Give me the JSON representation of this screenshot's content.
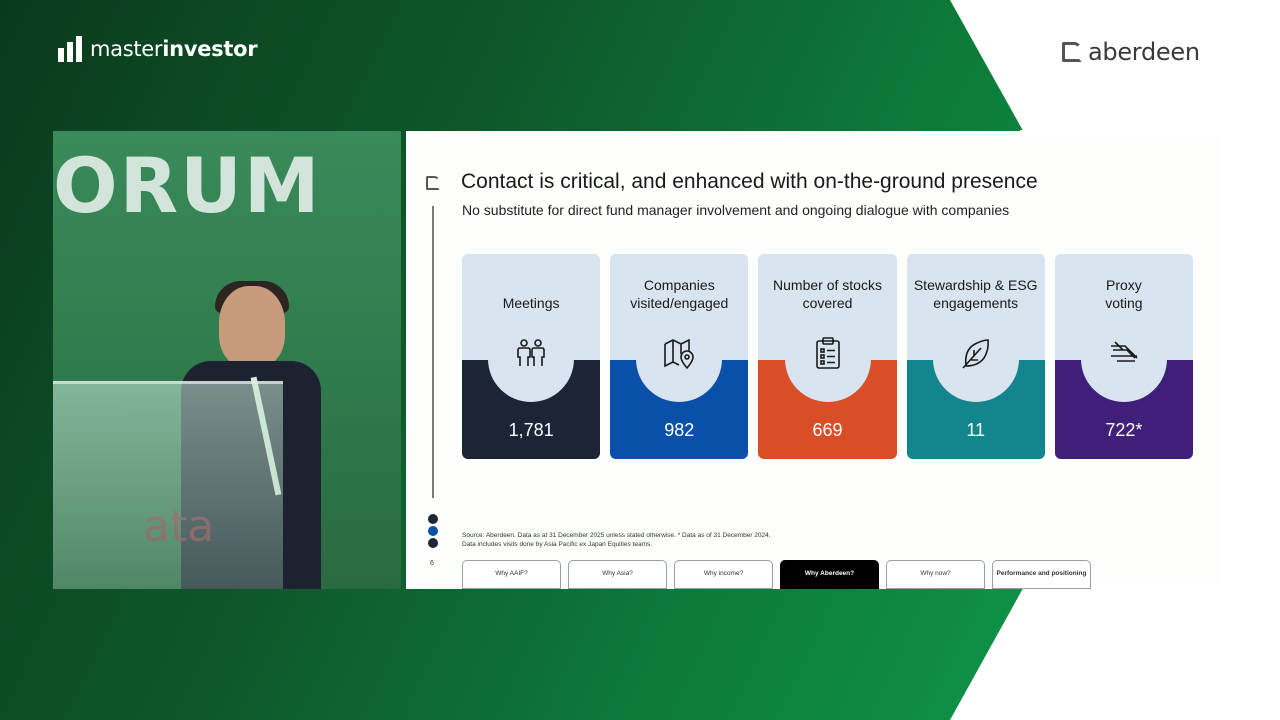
{
  "branding": {
    "left_logo_light": "master",
    "left_logo_bold": "investor",
    "right_logo": "aberdeen"
  },
  "video": {
    "backdrop_text": "ORUM",
    "backdrop_text_red": "ata"
  },
  "slide": {
    "title": "Contact is critical, and enhanced with on-the-ground presence",
    "subtitle": "No substitute for direct fund manager involvement and ongoing dialogue with companies",
    "cards": [
      {
        "label": "Meetings",
        "value": "1,781",
        "icon": "people-icon",
        "color": "#1b2535"
      },
      {
        "label": "Companies visited/engaged",
        "value": "982",
        "icon": "map-pin-icon",
        "color": "#0a4fa8"
      },
      {
        "label": "Number of stocks covered",
        "value": "669",
        "icon": "clipboard-list-icon",
        "color": "#d94e27"
      },
      {
        "label": "Stewardship & ESG engagements",
        "value": "11",
        "icon": "leaf-icon",
        "color": "#13858d"
      },
      {
        "label": "Proxy voting",
        "value": "722*",
        "icon": "vote-hand-icon",
        "color": "#3f1f7a"
      }
    ],
    "source_line1": "Source: Aberdeen. Data as at 31 December 2025 unless stated otherwise. * Data as of 31 December 2024.",
    "source_line2": "Data includes visits done by Asia Pacific ex Japan Equities teams.",
    "page_number": "6",
    "tabs": [
      {
        "label": "Why AAIF?"
      },
      {
        "label": "Why Asia?"
      },
      {
        "label": "Why income?"
      },
      {
        "label": "Why Aberdeen?"
      },
      {
        "label": "Why now?"
      },
      {
        "label": "Performance and positioning"
      }
    ]
  }
}
